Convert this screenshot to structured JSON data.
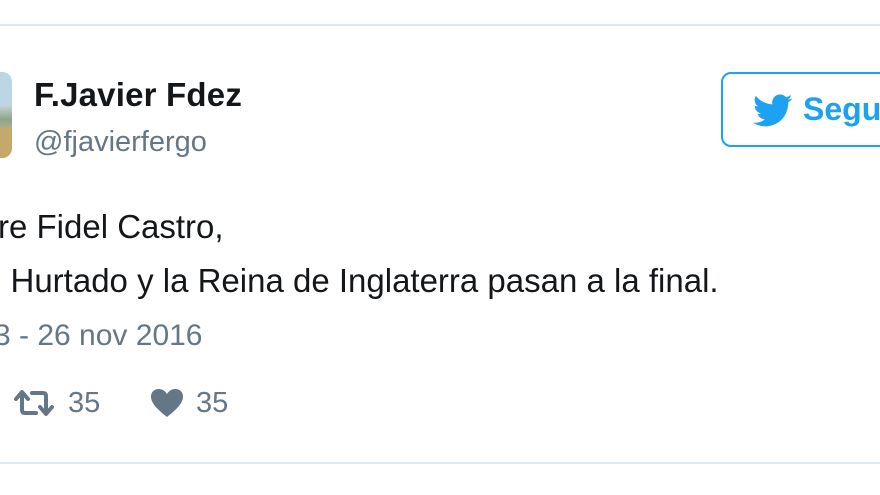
{
  "tweet": {
    "author": {
      "name": "F.Javier Fdez",
      "handle": "@fjavierfergo"
    },
    "follow_button": {
      "label": "Segu"
    },
    "text": {
      "line1": "re Fidel Castro,",
      "line2": "i Hurtado y la Reina de Inglaterra pasan a la final."
    },
    "timestamp": "3 - 26 nov 2016",
    "actions": {
      "retweet_count": "35",
      "like_count": "35"
    }
  },
  "colors": {
    "accent": "#1da1f2",
    "text_primary": "#14171a",
    "text_secondary": "#657786",
    "border": "#e1e8ed"
  },
  "icons": {
    "follow": "twitter-bird-icon",
    "retweet": "retweet-icon",
    "like": "heart-icon"
  }
}
